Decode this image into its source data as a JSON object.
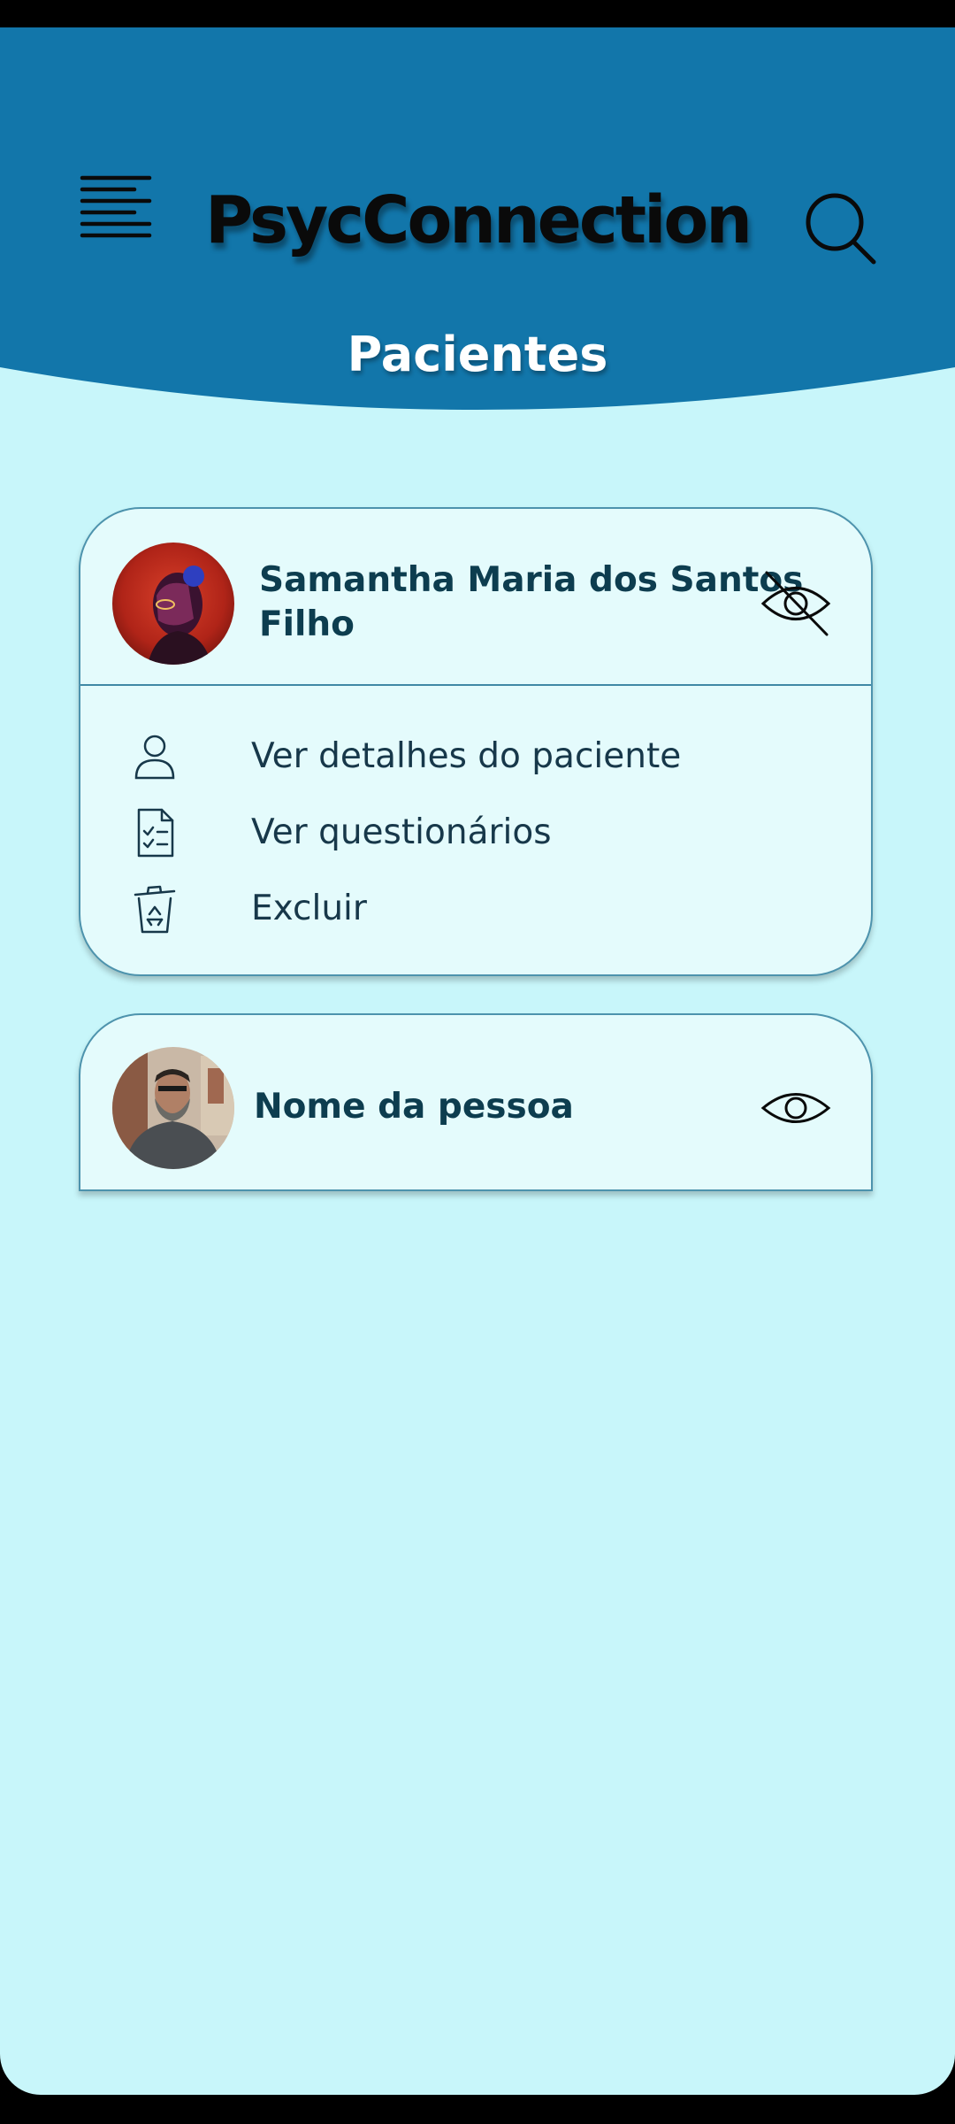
{
  "app": {
    "title": "PsycConnection",
    "page_title": "Pacientes",
    "header_color": "#1276aa",
    "background_color": "#c8f6fa",
    "card_color": "#e4fbfc",
    "text_color": "#0d3d4f"
  },
  "header": {
    "menu_icon": "menu-lines-icon",
    "search_icon": "search-icon"
  },
  "patients": [
    {
      "name": "Samantha Maria dos Santos Filho",
      "name_lines": [
        "Samantha Maria dos Santos",
        "Filho"
      ],
      "avatar": "avatar-photo",
      "visibility_icon": "eye-off-icon",
      "expanded": true,
      "actions": [
        {
          "label": "Ver detalhes do paciente",
          "icon": "user-icon"
        },
        {
          "label": "Ver questionários",
          "icon": "checklist-document-icon"
        },
        {
          "label": "Excluir",
          "icon": "trash-recycle-icon"
        }
      ]
    },
    {
      "name": "Nome da pessoa",
      "avatar": "avatar-photo",
      "visibility_icon": "eye-icon",
      "expanded": false
    }
  ]
}
